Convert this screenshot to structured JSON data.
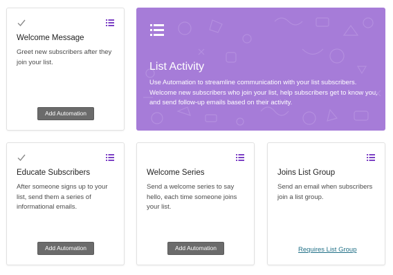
{
  "colors": {
    "accent": "#7b3fc4",
    "hero_bg": "#a67cd8",
    "button_bg": "#6b6b6b",
    "link": "#1f6f86"
  },
  "hero": {
    "icon": "list-icon",
    "title": "List Activity",
    "description": "Use Automation to streamline communication with your list subscribers. Welcome new subscribers who join your list, help subscribers get to know you, and send follow-up emails based on their activity."
  },
  "cards": [
    {
      "title": "Welcome Message",
      "description": "Greet new subscribers after they join your list.",
      "checked": true,
      "button": "Add Automation"
    },
    {
      "title": "Educate Subscribers",
      "description": "After someone signs up to your list, send them a series of informational emails.",
      "checked": true,
      "button": "Add Automation"
    },
    {
      "title": "Welcome Series",
      "description": "Send a welcome series to say hello, each time someone joins your list.",
      "checked": false,
      "button": "Add Automation"
    },
    {
      "title": "Joins List Group",
      "description": "Send an email when subscribers join a list group.",
      "checked": false,
      "link": "Requires List Group"
    }
  ]
}
